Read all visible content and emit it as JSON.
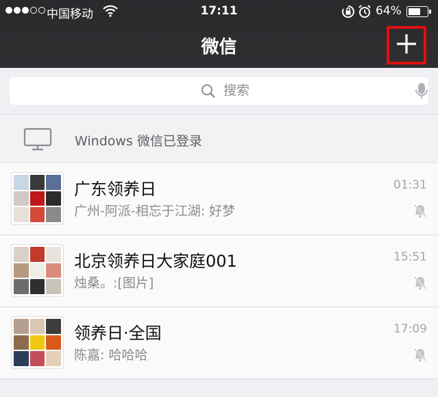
{
  "status_bar": {
    "carrier": "中国移动",
    "time": "17:11",
    "battery": "64%",
    "battery_level": 0.64,
    "signal_strength": 3,
    "signal_total": 5
  },
  "nav": {
    "title": "微信",
    "add_icon": "plus-icon",
    "highlight_color": "#e01010"
  },
  "search": {
    "placeholder": "搜索",
    "icon": "search-icon",
    "voice_icon": "microphone-icon"
  },
  "login_banner": {
    "text": "Windows 微信已登录",
    "icon": "monitor-icon"
  },
  "chats": [
    {
      "name": "广东领养日",
      "preview": "广州-阿派-相忘于江湖: 好梦",
      "time": "01:31",
      "muted": true,
      "avatar_colors": [
        "#c9d6e6",
        "#3a3a3a",
        "#5a6f9a",
        "#d1c9c3",
        "#c01818",
        "#2b2b2b",
        "#e8e0d8",
        "#d44a3a",
        "#8a8a8a"
      ]
    },
    {
      "name": "北京领养日大家庭001",
      "preview": "烛桑。:[图片]",
      "time": "15:51",
      "muted": true,
      "avatar_colors": [
        "#d9d0c6",
        "#c23a2a",
        "#e8e2dc",
        "#b59a82",
        "#f0ece6",
        "#d98c7a",
        "#6d6d6d",
        "#2f2f2f",
        "#c9c2b8"
      ]
    },
    {
      "name": "领养日·全国",
      "preview": "陈嘉: 哈哈哈",
      "time": "17:09",
      "muted": true,
      "avatar_colors": [
        "#b5a090",
        "#d9c7b5",
        "#3c3c3c",
        "#8b6b4a",
        "#f2c811",
        "#d85b1c",
        "#2c3d5a",
        "#c44d5c",
        "#e6cfb8"
      ]
    }
  ]
}
